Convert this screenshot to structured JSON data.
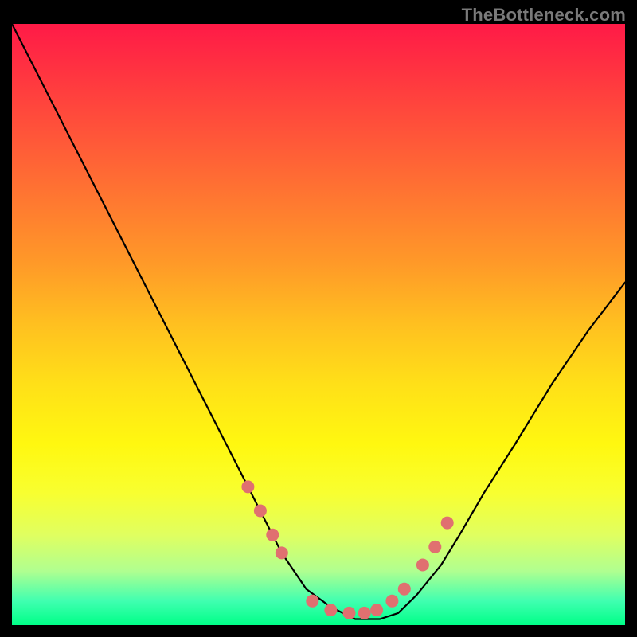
{
  "watermark": "TheBottleneck.com",
  "chart_data": {
    "type": "line",
    "title": "",
    "xlabel": "",
    "ylabel": "",
    "xlim": [
      0,
      100
    ],
    "ylim": [
      0,
      100
    ],
    "series": [
      {
        "name": "bottleneck-curve",
        "x": [
          0,
          5,
          10,
          15,
          20,
          25,
          30,
          35,
          38,
          41,
          44,
          48,
          52,
          56,
          60,
          63,
          66,
          70,
          73,
          77,
          82,
          88,
          94,
          100
        ],
        "y": [
          100,
          90,
          80,
          70,
          60,
          50,
          40,
          30,
          24,
          18,
          12,
          6,
          3,
          1,
          1,
          2,
          5,
          10,
          15,
          22,
          30,
          40,
          49,
          57
        ]
      }
    ],
    "markers": {
      "name": "highlight-dots",
      "color": "#e07070",
      "x": [
        38.5,
        40.5,
        42.5,
        44,
        49,
        52,
        55,
        57.5,
        59.5,
        62,
        64,
        67,
        69,
        71
      ],
      "y": [
        23,
        19,
        15,
        12,
        4,
        2.5,
        2,
        2,
        2.5,
        4,
        6,
        10,
        13,
        17
      ]
    },
    "background": "rainbow-gradient-vertical"
  }
}
